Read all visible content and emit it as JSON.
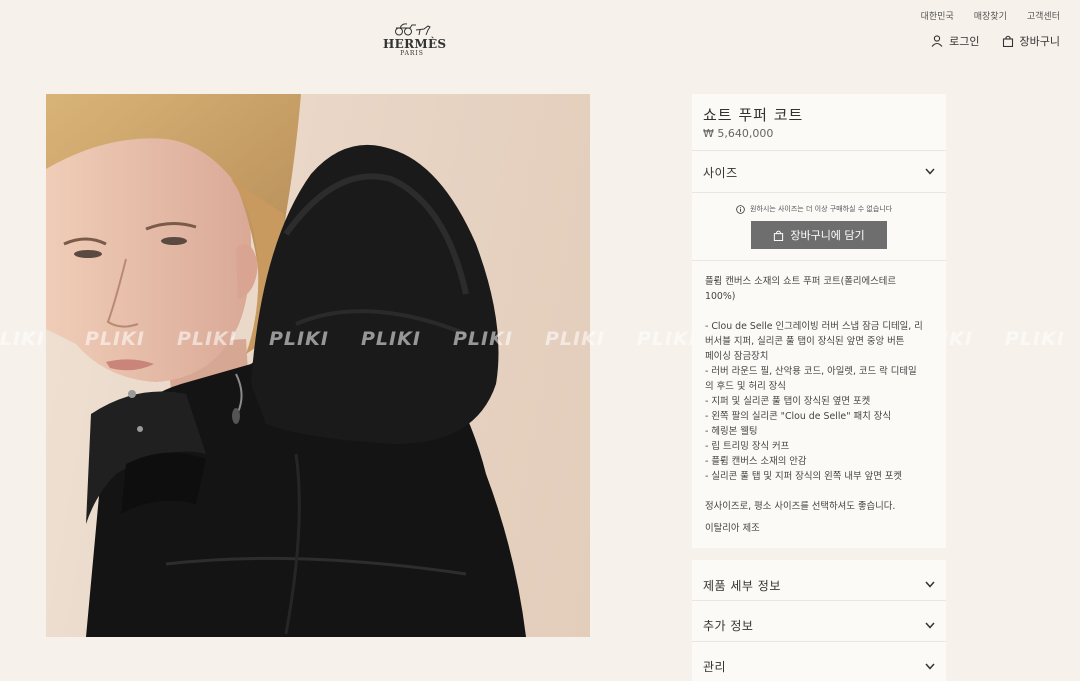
{
  "header": {
    "util_nav": [
      "대한민국",
      "매장찾기",
      "고객센터"
    ],
    "logo": {
      "name": "HERMÈS",
      "sub": "PARIS"
    },
    "login_label": "로그인",
    "cart_label": "장바구니"
  },
  "product": {
    "image_icon": "woman-in-black-hooded-puffer-coat",
    "title": "쇼트 푸퍼 코트",
    "price": "₩ 5,640,000",
    "size_label": "사이즈",
    "notice": "원하시는 사이즈는 더 이상 구매하실 수 없습니다",
    "add_to_cart": "장바구니에 담기",
    "description": {
      "intro": [
        "플륌 캔버스 소재의 쇼트 푸퍼 코트(폴리에스테르",
        "100%)"
      ],
      "features": [
        "- Clou de Selle 인그레이빙 러버 스냅 잠금 디테일, 리",
        "버서블 지퍼, 실리콘 풀 탭이 장식된 앞면 중앙 버튼",
        "페이싱 잠금장치",
        "- 러버 라운드 필, 산악용 코드, 아일렛, 코드 락 디테일",
        "의 후드 및 허리 장식",
        "- 지퍼 및 실리콘 풀 탭이 장식된 옆면 포켓",
        "- 왼쪽 팔의 실리콘 \"Clou de Selle\" 패치 장식",
        "- 헤링본 웰팅",
        "- 립 트리밍 장식 커프",
        "- 플륌 캔버스 소재의 안감",
        "- 실리콘 풀 탭 및 지퍼 장식의 왼쪽 내부 앞면 포켓"
      ],
      "sizing": "정사이즈로, 평소 사이즈를 선택하셔도 좋습니다.",
      "made_in": "이탈리아 제조"
    },
    "sections": [
      "제품 세부 정보",
      "추가 정보",
      "관리"
    ]
  },
  "watermark": [
    "PLIKI",
    "PLIKI",
    "PLIKI",
    "PLIKI",
    "PLIKI",
    "PLIKI",
    "PLIKI",
    "PLIKI",
    "PLIKI",
    "PLIKI",
    "PLIKI",
    "PLIKI"
  ]
}
